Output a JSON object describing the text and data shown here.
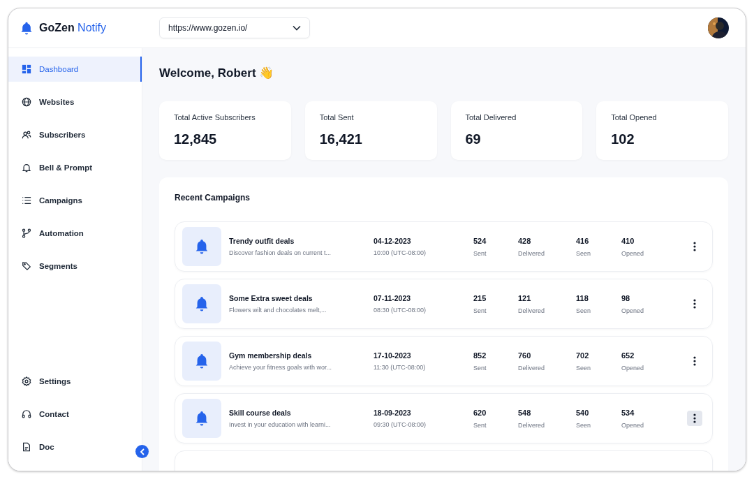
{
  "brand": {
    "name": "GoZen",
    "suffix": "Notify"
  },
  "site_select": {
    "value": "https://www.gozen.io/"
  },
  "nav": [
    {
      "label": "Dashboard",
      "selected": true
    },
    {
      "label": "Websites",
      "selected": false
    },
    {
      "label": "Subscribers",
      "selected": false
    },
    {
      "label": "Bell & Prompt",
      "selected": false
    },
    {
      "label": "Campaigns",
      "selected": false
    },
    {
      "label": "Automation",
      "selected": false
    },
    {
      "label": "Segments",
      "selected": false
    }
  ],
  "nav_bottom": [
    {
      "label": "Settings",
      "selected": false
    },
    {
      "label": "Contact",
      "selected": false
    },
    {
      "label": "Doc",
      "selected": false
    }
  ],
  "welcome": "Welcome, Robert 👋",
  "stats": [
    {
      "label": "Total Active Subscribers",
      "value": "12,845"
    },
    {
      "label": "Total Sent",
      "value": "16,421"
    },
    {
      "label": "Total Delivered",
      "value": "69"
    },
    {
      "label": "Total Opened",
      "value": "102"
    }
  ],
  "recent": {
    "title": "Recent Campaigns",
    "rows": [
      {
        "title": "Trendy outfit deals",
        "desc": "Discover fashion deals on current t...",
        "date": "04-12-2023",
        "time": "10:00 (UTC-08:00)",
        "metrics": [
          {
            "value": "524",
            "label": "Sent"
          },
          {
            "value": "428",
            "label": "Delivered"
          },
          {
            "value": "416",
            "label": "Seen"
          },
          {
            "value": "410",
            "label": "Opened"
          }
        ],
        "menu_hovered": false
      },
      {
        "title": "Some Extra sweet deals",
        "desc": "Flowers wilt and chocolates melt,...",
        "date": "07-11-2023",
        "time": "08:30 (UTC-08:00)",
        "metrics": [
          {
            "value": "215",
            "label": "Sent"
          },
          {
            "value": "121",
            "label": "Delivered"
          },
          {
            "value": "118",
            "label": "Seen"
          },
          {
            "value": "98",
            "label": "Opened"
          }
        ],
        "menu_hovered": false
      },
      {
        "title": "Gym membership deals",
        "desc": "Achieve your fitness goals with wor...",
        "date": "17-10-2023",
        "time": "11:30 (UTC-08:00)",
        "metrics": [
          {
            "value": "852",
            "label": "Sent"
          },
          {
            "value": "760",
            "label": "Delivered"
          },
          {
            "value": "702",
            "label": "Seen"
          },
          {
            "value": "652",
            "label": "Opened"
          }
        ],
        "menu_hovered": false
      },
      {
        "title": "Skill course deals",
        "desc": "Invest in your education with learni...",
        "date": "18-09-2023",
        "time": "09:30 (UTC-08:00)",
        "metrics": [
          {
            "value": "620",
            "label": "Sent"
          },
          {
            "value": "548",
            "label": "Delivered"
          },
          {
            "value": "540",
            "label": "Seen"
          },
          {
            "value": "534",
            "label": "Opened"
          }
        ],
        "menu_hovered": true
      }
    ]
  }
}
